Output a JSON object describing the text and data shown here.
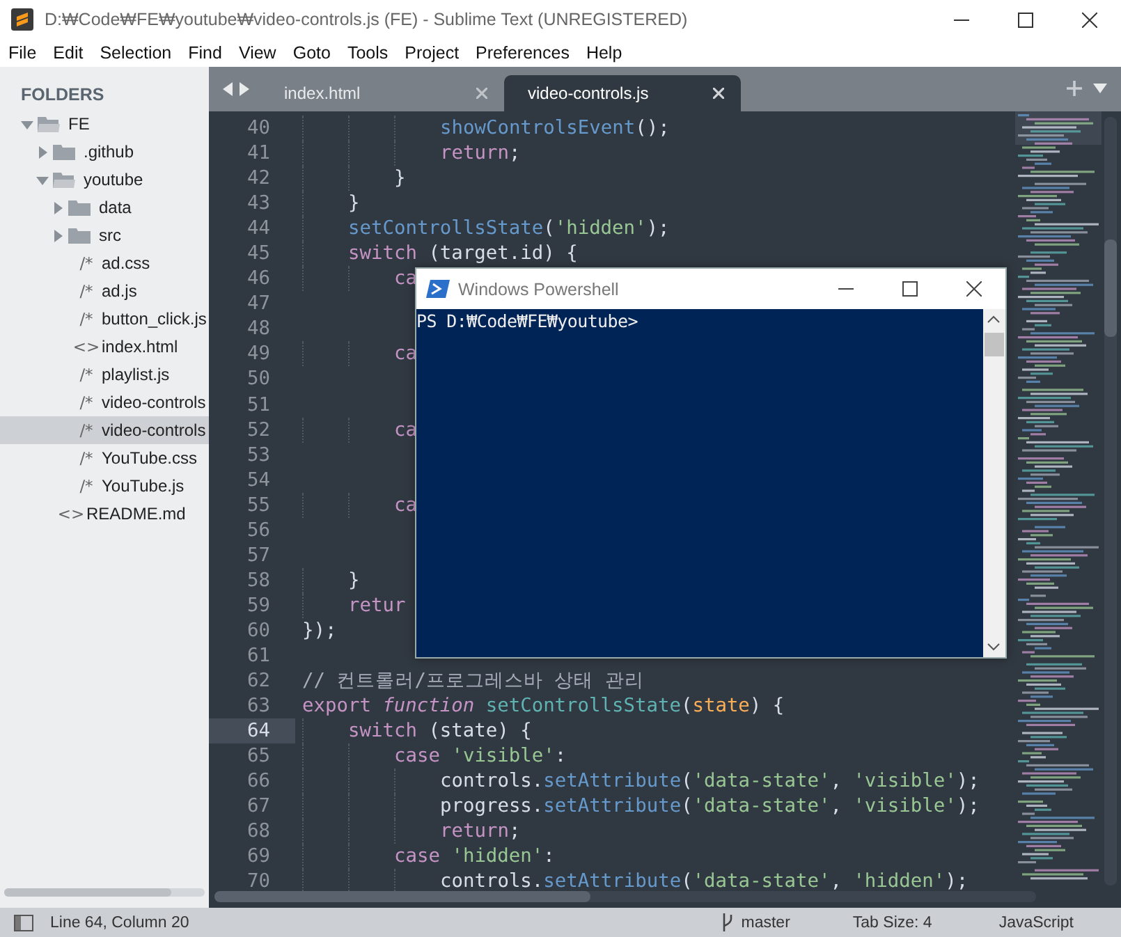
{
  "window": {
    "title": "D:₩Code₩FE₩youtube₩video-controls.js (FE) - Sublime Text (UNREGISTERED)"
  },
  "menu": [
    "File",
    "Edit",
    "Selection",
    "Find",
    "View",
    "Goto",
    "Tools",
    "Project",
    "Preferences",
    "Help"
  ],
  "sidebar": {
    "heading": "FOLDERS",
    "tree": [
      {
        "kind": "folder",
        "label": "FE",
        "expanded": true,
        "selected": false,
        "children": [
          {
            "kind": "folder",
            "label": ".github",
            "expanded": false,
            "selected": false
          },
          {
            "kind": "folder",
            "label": "youtube",
            "expanded": true,
            "selected": false,
            "children": [
              {
                "kind": "folder",
                "label": "data",
                "expanded": false,
                "selected": false
              },
              {
                "kind": "folder",
                "label": "src",
                "expanded": false,
                "selected": false
              },
              {
                "kind": "file",
                "glyph": "/*",
                "label": "ad.css",
                "selected": false
              },
              {
                "kind": "file",
                "glyph": "/*",
                "label": "ad.js",
                "selected": false
              },
              {
                "kind": "file",
                "glyph": "/*",
                "label": "button_click.js",
                "selected": false
              },
              {
                "kind": "file",
                "glyph": "<>",
                "label": "index.html",
                "selected": false
              },
              {
                "kind": "file",
                "glyph": "/*",
                "label": "playlist.js",
                "selected": false
              },
              {
                "kind": "file",
                "glyph": "/*",
                "label": "video-controls",
                "selected": false
              },
              {
                "kind": "file",
                "glyph": "/*",
                "label": "video-controls",
                "selected": true
              },
              {
                "kind": "file",
                "glyph": "/*",
                "label": "YouTube.css",
                "selected": false
              },
              {
                "kind": "file",
                "glyph": "/*",
                "label": "YouTube.js",
                "selected": false
              }
            ]
          },
          {
            "kind": "file",
            "glyph": "<>",
            "label": "README.md",
            "selected": false
          }
        ]
      }
    ]
  },
  "tabs": [
    {
      "label": "index.html",
      "selected": false
    },
    {
      "label": "video-controls.js",
      "selected": true
    }
  ],
  "editor": {
    "lines": [
      {
        "number": "40",
        "current": false,
        "tokens": [
          {
            "text": "            showControlsEvent",
            "kind": "call"
          },
          {
            "text": "();",
            "kind": "plain"
          }
        ]
      },
      {
        "number": "41",
        "current": false,
        "tokens": [
          {
            "text": "            return",
            "kind": "keyword"
          },
          {
            "text": ";",
            "kind": "plain"
          }
        ]
      },
      {
        "number": "42",
        "current": false,
        "tokens": [
          {
            "text": "        }",
            "kind": "plain"
          }
        ]
      },
      {
        "number": "43",
        "current": false,
        "tokens": [
          {
            "text": "    }",
            "kind": "plain"
          }
        ]
      },
      {
        "number": "44",
        "current": false,
        "tokens": [
          {
            "text": "    setControllsState",
            "kind": "call"
          },
          {
            "text": "(",
            "kind": "plain"
          },
          {
            "text": "'hidden'",
            "kind": "string"
          },
          {
            "text": ");",
            "kind": "plain"
          }
        ]
      },
      {
        "number": "45",
        "current": false,
        "tokens": [
          {
            "text": "    switch",
            "kind": "keyword"
          },
          {
            "text": " (target.id) {",
            "kind": "plain"
          }
        ]
      },
      {
        "number": "46",
        "current": false,
        "tokens": [
          {
            "text": "        ca",
            "kind": "keyword"
          }
        ]
      },
      {
        "number": "47",
        "current": false
      },
      {
        "number": "48",
        "current": false
      },
      {
        "number": "49",
        "current": false,
        "tokens": [
          {
            "text": "        ca",
            "kind": "keyword"
          }
        ]
      },
      {
        "number": "50",
        "current": false
      },
      {
        "number": "51",
        "current": false
      },
      {
        "number": "52",
        "current": false,
        "tokens": [
          {
            "text": "        ca",
            "kind": "keyword"
          }
        ]
      },
      {
        "number": "53",
        "current": false
      },
      {
        "number": "54",
        "current": false
      },
      {
        "number": "55",
        "current": false,
        "tokens": [
          {
            "text": "        ca",
            "kind": "keyword"
          }
        ]
      },
      {
        "number": "56",
        "current": false
      },
      {
        "number": "57",
        "current": false
      },
      {
        "number": "58",
        "current": false,
        "tokens": [
          {
            "text": "    }",
            "kind": "plain"
          }
        ]
      },
      {
        "number": "59",
        "current": false,
        "tokens": [
          {
            "text": "    retur",
            "kind": "keyword"
          }
        ]
      },
      {
        "number": "60",
        "current": false,
        "tokens": [
          {
            "text": "});",
            "kind": "plain"
          }
        ]
      },
      {
        "number": "61",
        "current": false
      },
      {
        "number": "62",
        "current": false,
        "tokens": [
          {
            "text": "// 컨트롤러/프로그레스바 상태 관리",
            "kind": "comment"
          }
        ]
      },
      {
        "number": "63",
        "current": false,
        "tokens": [
          {
            "text": "export",
            "kind": "keyword"
          },
          {
            "text": " function",
            "kind": "storage"
          },
          {
            "text": " setControllsState",
            "kind": "name"
          },
          {
            "text": "(",
            "kind": "plain"
          },
          {
            "text": "state",
            "kind": "param"
          },
          {
            "text": ") {",
            "kind": "plain"
          }
        ]
      },
      {
        "number": "64",
        "current": true,
        "tokens": [
          {
            "text": "    switch",
            "kind": "keyword"
          },
          {
            "text": " (state) {",
            "kind": "plain"
          }
        ]
      },
      {
        "number": "65",
        "current": false,
        "tokens": [
          {
            "text": "        case",
            "kind": "keyword"
          },
          {
            "text": " 'visible'",
            "kind": "string"
          },
          {
            "text": ":",
            "kind": "plain"
          }
        ]
      },
      {
        "number": "66",
        "current": false,
        "tokens": [
          {
            "text": "            controls.",
            "kind": "plain"
          },
          {
            "text": "setAttribute",
            "kind": "call"
          },
          {
            "text": "(",
            "kind": "plain"
          },
          {
            "text": "'data-state'",
            "kind": "string"
          },
          {
            "text": ", ",
            "kind": "plain"
          },
          {
            "text": "'visible'",
            "kind": "string"
          },
          {
            "text": ");",
            "kind": "plain"
          }
        ]
      },
      {
        "number": "67",
        "current": false,
        "tokens": [
          {
            "text": "            progress.",
            "kind": "plain"
          },
          {
            "text": "setAttribute",
            "kind": "call"
          },
          {
            "text": "(",
            "kind": "plain"
          },
          {
            "text": "'data-state'",
            "kind": "string"
          },
          {
            "text": ", ",
            "kind": "plain"
          },
          {
            "text": "'visible'",
            "kind": "string"
          },
          {
            "text": ");",
            "kind": "plain"
          }
        ]
      },
      {
        "number": "68",
        "current": false,
        "tokens": [
          {
            "text": "            return",
            "kind": "keyword"
          },
          {
            "text": ";",
            "kind": "plain"
          }
        ]
      },
      {
        "number": "69",
        "current": false,
        "tokens": [
          {
            "text": "        case",
            "kind": "keyword"
          },
          {
            "text": " 'hidden'",
            "kind": "string"
          },
          {
            "text": ":",
            "kind": "plain"
          }
        ]
      },
      {
        "number": "70",
        "current": false,
        "tokens": [
          {
            "text": "            controls.",
            "kind": "plain"
          },
          {
            "text": "setAttribute",
            "kind": "call"
          },
          {
            "text": "(",
            "kind": "plain"
          },
          {
            "text": "'data-state'",
            "kind": "string"
          },
          {
            "text": ", ",
            "kind": "plain"
          },
          {
            "text": "'hidden'",
            "kind": "string"
          },
          {
            "text": ");",
            "kind": "plain"
          }
        ]
      }
    ]
  },
  "powershell": {
    "title": "Windows Powershell",
    "output": "PS D:₩Code₩FE₩youtube>"
  },
  "status_bar": {
    "position": "Line 64, Column 20",
    "branch": "master",
    "tab_size": "Tab Size: 4",
    "syntax": "JavaScript"
  }
}
